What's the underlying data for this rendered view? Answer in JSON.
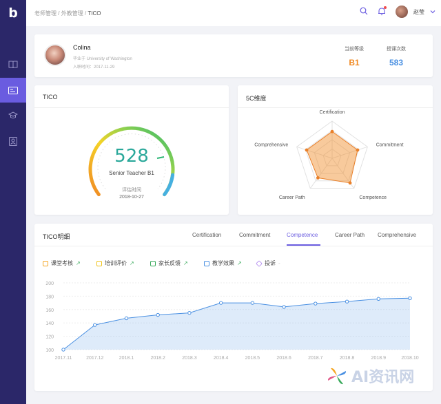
{
  "breadcrumb": {
    "items": [
      "老师管理",
      "外教管理"
    ],
    "sep": "/",
    "current": "TICO"
  },
  "user": {
    "name": "赵莹"
  },
  "profile": {
    "name": "Colina",
    "graduated": "毕业于 University of Washington",
    "joined": "入职时间：2017-11-29",
    "level_label": "当前等级",
    "level_value": "B1",
    "count_label": "授课次数",
    "count_value": "583"
  },
  "tico": {
    "title": "TICO",
    "score": "528",
    "score_value": 528,
    "level_text": "Senior Teacher B1",
    "eval_label": "评估时间",
    "eval_date": "2018-10-27"
  },
  "radar": {
    "title": "5C维度",
    "axes": [
      "Certification",
      "Commitment",
      "Competence",
      "Career Path",
      "Comprehensive"
    ],
    "values": [
      0.72,
      0.72,
      0.82,
      0.65,
      0.72
    ]
  },
  "detail": {
    "title": "TICO明细",
    "tabs": [
      "Certification",
      "Commitment",
      "Competence",
      "Career Path",
      "Comprehensive"
    ],
    "active_tab": 2,
    "legend": [
      {
        "label": "课堂考核",
        "color": "#f5a623"
      },
      {
        "label": "培训评价",
        "color": "#f0c419"
      },
      {
        "label": "家长反馈",
        "color": "#3aaa5c"
      },
      {
        "label": "教学效果",
        "color": "#4a90e2"
      },
      {
        "label": "投诉",
        "color": "#b38cf0"
      }
    ]
  },
  "chart_data": {
    "type": "area",
    "x": [
      "2017.11",
      "2017.12",
      "2018.1",
      "2018.2",
      "2018.3",
      "2018.4",
      "2018.5",
      "2018.6",
      "2018.7",
      "2018.8",
      "2018.9",
      "2018.10"
    ],
    "y": [
      100,
      137,
      147,
      152,
      155,
      170,
      170,
      164,
      169,
      172,
      176,
      177
    ],
    "ylim": [
      100,
      200
    ],
    "yticks": [
      100,
      120,
      140,
      160,
      180,
      200
    ],
    "grid": true,
    "color": "#4a90e2"
  },
  "watermark": "AI资讯网"
}
